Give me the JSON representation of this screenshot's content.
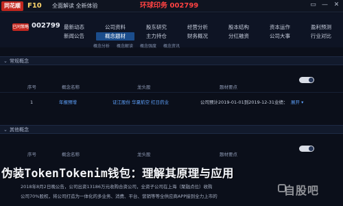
{
  "app": {
    "logo": "同花顺",
    "name": "F10",
    "slogan": "全面解读 全新体验",
    "window_title": "环球印务 002799",
    "controls": [
      "▭",
      "—",
      "✕"
    ]
  },
  "stock": {
    "badge": "已同策略",
    "code": "002799"
  },
  "nav": {
    "items": [
      "最新动态",
      "公司资料",
      "股东研究",
      "经营分析",
      "股本结构",
      "资本运作",
      "盈利预测",
      "新闻公告",
      "概念题材",
      "主力持仓",
      "财务概况",
      "分红融资",
      "公司大事",
      "行业对比"
    ],
    "active_index": 8
  },
  "subnav": [
    "概念分析",
    "概念解读",
    "概念强度",
    "概念资讯"
  ],
  "panel1": {
    "title": "常规概念",
    "columns": [
      "序号",
      "概念名称",
      "龙头股",
      "题材要点",
      ""
    ],
    "rows": [
      {
        "index": "1",
        "name": "年报预增",
        "leaders": "证江股份  华夏航空  红日药业",
        "point": "公司预计2019-01-01到2019-12-31业绩：",
        "action": "展开 ▾"
      }
    ]
  },
  "panel2": {
    "title": "其他概念",
    "columns": [
      "序号",
      "概念名称",
      "龙头股",
      "题材要点",
      ""
    ]
  },
  "overlay": {
    "title": "伪装TokenTokenim钱包：理解其原理与应用",
    "lines": [
      "2018年8月2日晚公告，公司出资13186万元收购合资公司，全资子公司在上海（聚融点位）收购",
      "公司70%股权，将公司打造为一体化的多业务、消费、平台、营销等等全供应商APP接到全力上市的"
    ],
    "watermark": "自股吧"
  },
  "colors": {
    "background": "#0b0f1a",
    "accent_red": "#c3271f",
    "active_nav": "#1b4d8c",
    "link_blue": "#5fa3ff"
  }
}
